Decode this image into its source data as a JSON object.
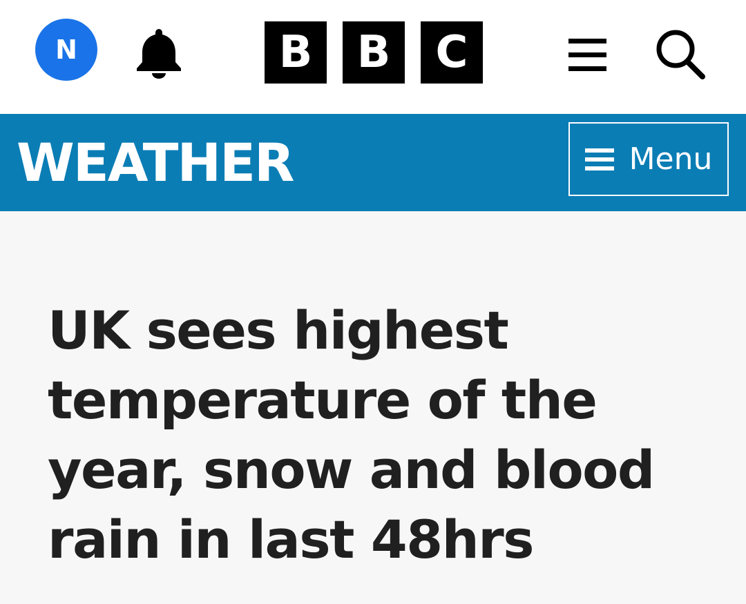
{
  "header": {
    "avatar_letter": "N",
    "avatar_color": "#1a73e8",
    "notification_icon": "bell-icon",
    "logo_letters": [
      "B",
      "B",
      "C"
    ],
    "menu_icon": "hamburger-icon",
    "search_icon": "search-icon"
  },
  "section_bar": {
    "title": "WEATHER",
    "background_color": "#0b7db5",
    "menu_label": "Menu",
    "menu_icon": "hamburger-icon"
  },
  "article": {
    "headline": "UK sees highest temperature of the year, snow and blood rain in last 48hrs"
  }
}
